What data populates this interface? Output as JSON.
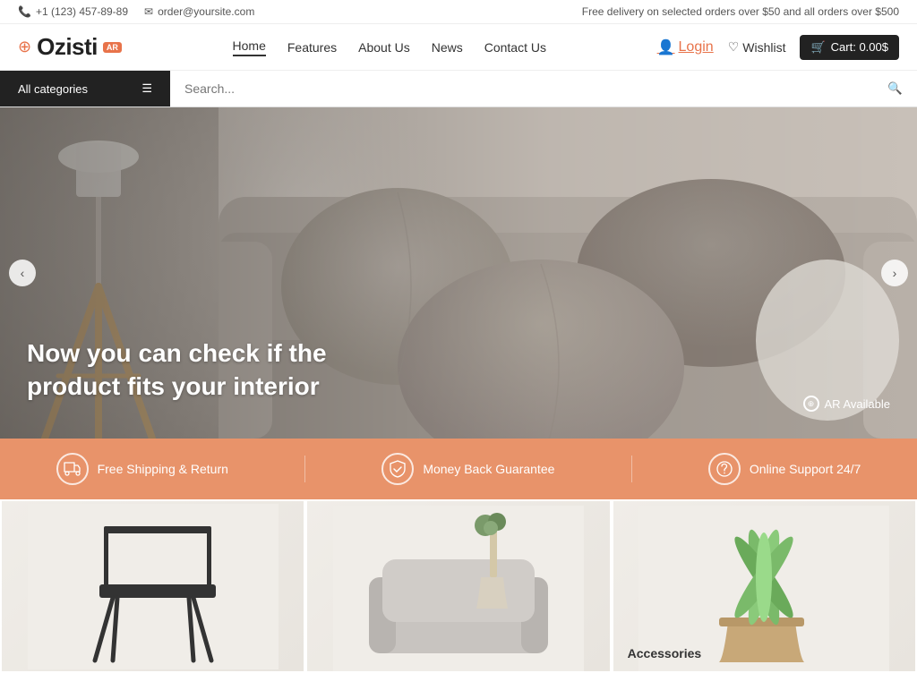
{
  "topbar": {
    "phone": "+1 (123) 457-89-89",
    "email": "order@yoursite.com",
    "promo": "Free delivery on selected orders over $50 and all orders over $500",
    "phone_icon": "📞",
    "email_icon": "✉"
  },
  "header": {
    "logo_text": "Ozisti",
    "logo_ar": "AR",
    "nav": {
      "items": [
        {
          "label": "Home",
          "active": true
        },
        {
          "label": "Features"
        },
        {
          "label": "About Us"
        },
        {
          "label": "News"
        },
        {
          "label": "Contact Us"
        }
      ]
    },
    "login_label": "Login",
    "wishlist_label": "Wishlist",
    "cart_label": "Cart: 0.00$"
  },
  "search": {
    "categories_label": "All categories",
    "placeholder": "Search..."
  },
  "hero": {
    "title": "Now you can check if the product fits your interior",
    "ar_badge": "AR Available",
    "prev_label": "←",
    "next_label": "→"
  },
  "features": [
    {
      "icon": "🚚",
      "label": "Free Shipping & Return"
    },
    {
      "icon": "🛡",
      "label": "Money Back Guarantee"
    },
    {
      "icon": "📞",
      "label": "Online Support 24/7"
    }
  ],
  "products": [
    {
      "label": "",
      "type": "chair"
    },
    {
      "label": "",
      "type": "sofa"
    },
    {
      "label": "Accessories",
      "type": "plant"
    }
  ]
}
